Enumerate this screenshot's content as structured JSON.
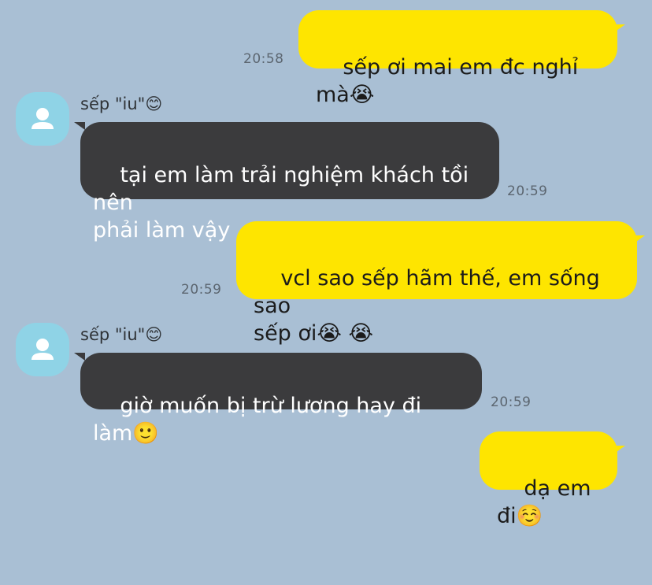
{
  "app": {
    "accent_outgoing": "#fee500",
    "accent_incoming": "#3b3b3d",
    "background": "#a9bfd4",
    "avatar_color": "#8fd3e6"
  },
  "messages": [
    {
      "direction": "out",
      "text": "sếp ơi mai em đc nghỉ mà😭",
      "time": "20:58"
    },
    {
      "direction": "in",
      "sender": "sếp \"iu\"😊",
      "avatar_icon": "person-icon",
      "text": "tại em làm trải nghiệm khách tồi nên\nphải làm vậy",
      "time": "20:59"
    },
    {
      "direction": "out",
      "text": "vcl sao sếp hãm thế, em sống sao\nsếp ơi😭 😭",
      "time": "20:59"
    },
    {
      "direction": "in",
      "sender": "sếp \"iu\"😊",
      "avatar_icon": "person-icon",
      "text": "giờ muốn bị trừ lương hay đi làm🙂",
      "time": "20:59"
    },
    {
      "direction": "out",
      "text": "dạ em đi☺️",
      "time": ""
    }
  ]
}
